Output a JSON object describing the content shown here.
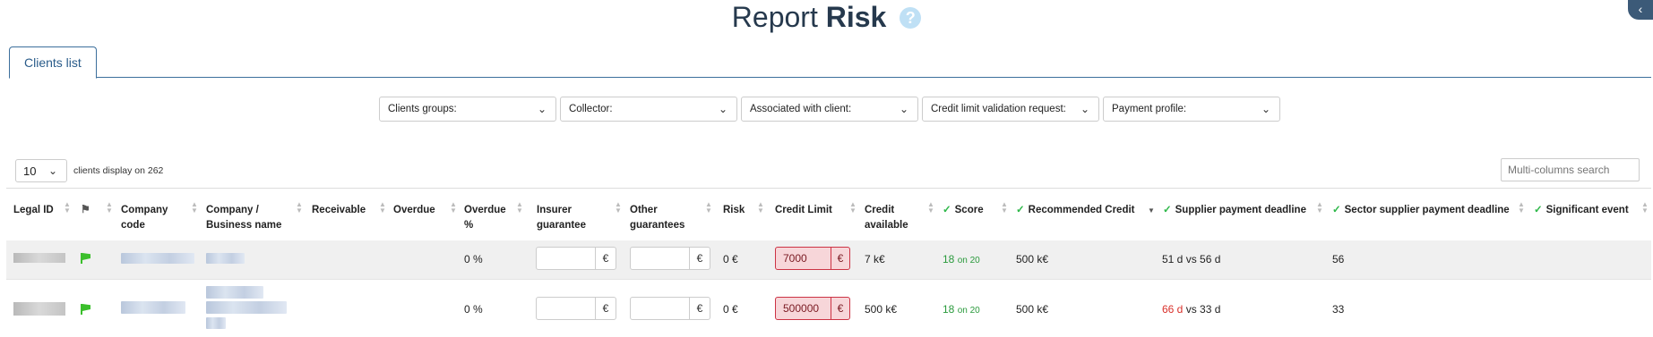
{
  "page": {
    "title_light": "Report",
    "title_bold": "Risk",
    "help_icon": "?",
    "corner_icon": "‹"
  },
  "tabs": [
    {
      "label": "Clients list"
    }
  ],
  "filters": [
    {
      "label": "Clients groups:"
    },
    {
      "label": "Collector:"
    },
    {
      "label": "Associated with client:"
    },
    {
      "label": "Credit limit validation request:"
    },
    {
      "label": "Payment profile:"
    }
  ],
  "table_controls": {
    "page_length": "10",
    "info_text": "clients display on 262",
    "search_placeholder": "Multi-columns search"
  },
  "columns": [
    {
      "label": "Legal ID"
    },
    {
      "label": ""
    },
    {
      "label": "Company code"
    },
    {
      "label": "Company / Business name"
    },
    {
      "label": "Receivable"
    },
    {
      "label": "Overdue"
    },
    {
      "label": "Overdue %"
    },
    {
      "label": "Insurer guarantee"
    },
    {
      "label": "Other guarantees"
    },
    {
      "label": "Risk"
    },
    {
      "label": "Credit Limit"
    },
    {
      "label": "Credit available"
    },
    {
      "label": "Score"
    },
    {
      "label": "Recommended Credit"
    },
    {
      "label": "Supplier payment deadline"
    },
    {
      "label": "Sector supplier payment deadline"
    },
    {
      "label": "Significant event"
    }
  ],
  "rows": [
    {
      "overdue_pct": "0 %",
      "insurer_currency": "€",
      "other_currency": "€",
      "risk": "0 €",
      "credit_limit": "7000",
      "credit_limit_currency": "€",
      "credit_available": "7 k€",
      "score_value": "18",
      "score_suffix": "on 20",
      "recommended_credit": "500 k€",
      "supplier_deadline_actual": "51 d",
      "supplier_deadline_rest": "vs 56 d",
      "supplier_deadline_late": false,
      "sector_deadline": "56"
    },
    {
      "overdue_pct": "0 %",
      "insurer_currency": "€",
      "other_currency": "€",
      "risk": "0 €",
      "credit_limit": "500000",
      "credit_limit_currency": "€",
      "credit_available": "500 k€",
      "score_value": "18",
      "score_suffix": "on 20",
      "recommended_credit": "500 k€",
      "supplier_deadline_actual": "66 d",
      "supplier_deadline_rest": "vs 33 d",
      "supplier_deadline_late": true,
      "sector_deadline": "33"
    }
  ],
  "colors": {
    "accent": "#2a5c8a",
    "score_green": "#2a9a3c",
    "late_red": "#d9302a",
    "flag_green": "#3bbf2c",
    "credit_limit_bg": "#f7d6d9"
  }
}
